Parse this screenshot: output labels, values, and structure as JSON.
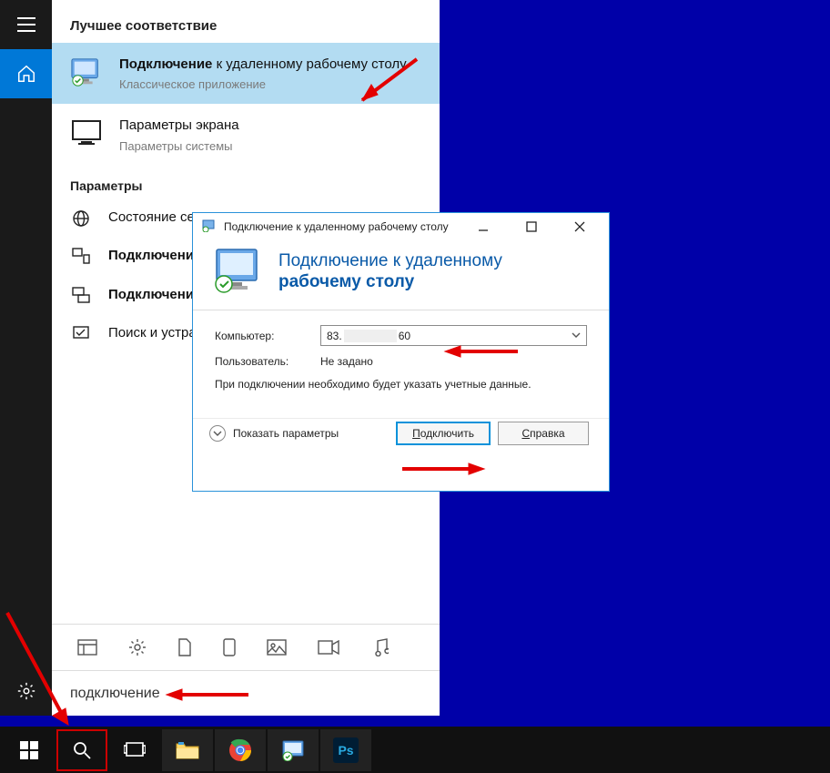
{
  "start": {
    "best_match_header": "Лучшее соответствие",
    "results": [
      {
        "title_html": "<b>Подключение</b> к удаленному рабочему столу",
        "sub": "Классическое приложение"
      },
      {
        "title_html": "Параметры экрана",
        "sub": "Параметры системы"
      }
    ],
    "params_header": "Параметры",
    "params": [
      "Состояние сети",
      "<b>Подключение</b>",
      "<b>Подключение</b> Xbox One",
      "Поиск и устранение и <b>подключени</b>"
    ],
    "search_value": "подключение"
  },
  "rdp": {
    "window_title": "Подключение к удаленному рабочему столу",
    "head_line1": "Подключение к удаленному",
    "head_line2": "рабочему столу",
    "label_computer": "Компьютер:",
    "value_computer_prefix": "83.",
    "value_computer_suffix": "60",
    "label_user": "Пользователь:",
    "value_user": "Не задано",
    "info": "При подключении необходимо будет указать учетные данные.",
    "show_params": "Показать параметры",
    "btn_connect": "Подключить",
    "btn_help": "Справка"
  }
}
